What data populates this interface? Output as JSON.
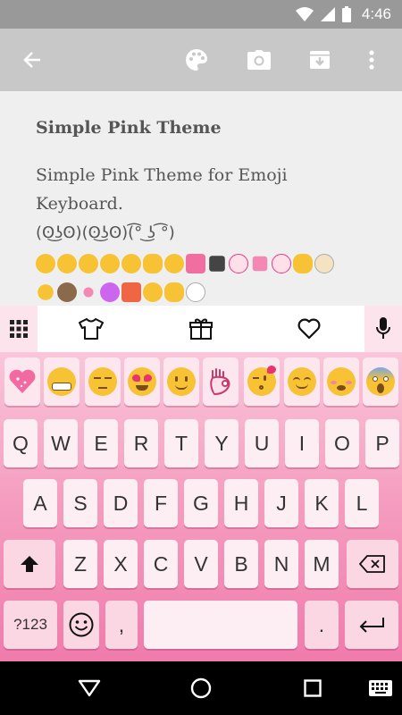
{
  "status_bar": {
    "time": "4:46"
  },
  "note": {
    "title": "Simple Pink Theme",
    "body": "Simple Pink Theme for Emoji Keyboard.",
    "kaomoji": "(ʘ͜ʖʘ)(ʘ͜ʖʘ)(͡° ͜ʖ ͡°)"
  },
  "keyboard": {
    "row1": [
      "Q",
      "W",
      "E",
      "R",
      "T",
      "Y",
      "U",
      "I",
      "O",
      "P"
    ],
    "row2": [
      "A",
      "S",
      "D",
      "F",
      "G",
      "H",
      "J",
      "K",
      "L"
    ],
    "row3": [
      "Z",
      "X",
      "C",
      "V",
      "B",
      "N",
      "M"
    ],
    "symbols_label": "?123",
    "comma": ",",
    "period": "."
  },
  "colors": {
    "accent": "#f07bac",
    "key_bg": "#fdeef3",
    "status_bg": "#999999",
    "toolbar_bg": "#c8c8c8"
  }
}
